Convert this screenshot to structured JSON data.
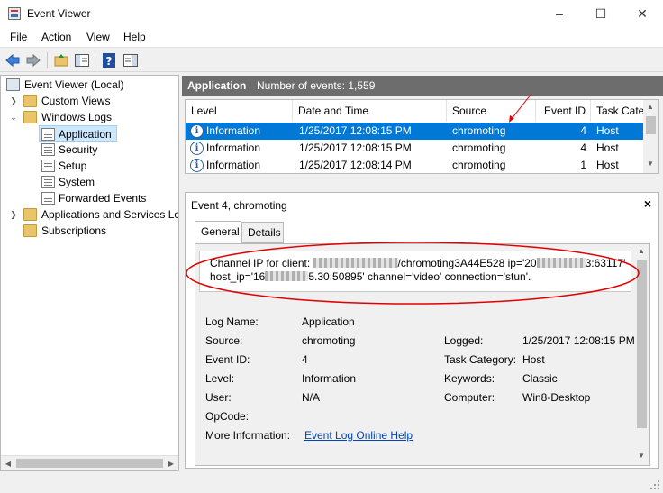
{
  "window": {
    "title": "Event Viewer",
    "controls": [
      "minimize",
      "maximize",
      "close"
    ]
  },
  "menu": [
    "File",
    "Action",
    "View",
    "Help"
  ],
  "toolbar": {
    "icons": [
      "back-icon",
      "forward-icon",
      "up-folder-icon",
      "show-hide-tree-icon",
      "help-icon",
      "show-hide-action-pane-icon"
    ]
  },
  "tree": {
    "items": [
      {
        "label": "Event Viewer (Local)",
        "level": 0,
        "icon": "computer-icon",
        "expander": ""
      },
      {
        "label": "Custom Views",
        "level": 1,
        "icon": "folder-icon",
        "expander": "collapsed"
      },
      {
        "label": "Windows Logs",
        "level": 1,
        "icon": "folder-icon",
        "expander": "expanded"
      },
      {
        "label": "Application",
        "level": 2,
        "icon": "log-icon",
        "expander": "",
        "selected": true
      },
      {
        "label": "Security",
        "level": 2,
        "icon": "log-icon",
        "expander": ""
      },
      {
        "label": "Setup",
        "level": 2,
        "icon": "log-icon",
        "expander": ""
      },
      {
        "label": "System",
        "level": 2,
        "icon": "log-icon",
        "expander": ""
      },
      {
        "label": "Forwarded Events",
        "level": 2,
        "icon": "log-icon",
        "expander": ""
      },
      {
        "label": "Applications and Services Lo",
        "level": 1,
        "icon": "folder-icon",
        "expander": "collapsed"
      },
      {
        "label": "Subscriptions",
        "level": 1,
        "icon": "folder-icon",
        "expander": ""
      }
    ]
  },
  "log_header": {
    "title": "Application",
    "count": "Number of events: 1,559"
  },
  "events": {
    "columns": [
      "Level",
      "Date and Time",
      "Source",
      "Event ID",
      "Task Categ"
    ],
    "rows": [
      {
        "level": "Information",
        "datetime": "1/25/2017 12:08:15 PM",
        "source": "chromoting",
        "event_id": "4",
        "task": "Host",
        "selected": true
      },
      {
        "level": "Information",
        "datetime": "1/25/2017 12:08:15 PM",
        "source": "chromoting",
        "event_id": "4",
        "task": "Host"
      },
      {
        "level": "Information",
        "datetime": "1/25/2017 12:08:14 PM",
        "source": "chromoting",
        "event_id": "1",
        "task": "Host"
      }
    ]
  },
  "detail": {
    "title": "Event 4, chromoting",
    "close": "×",
    "tabs": [
      "General",
      "Details"
    ],
    "message": {
      "line1_a": "Channel IP for client: ",
      "line1_b": "/chromoting3A44E528 ip='20",
      "line1_c": "3:63117'",
      "line2_a": "host_ip='16",
      "line2_b": "5.30:50895' channel='video' connection='stun'."
    },
    "fields": {
      "log_name_label": "Log Name:",
      "log_name": "Application",
      "source_label": "Source:",
      "source": "chromoting",
      "logged_label": "Logged:",
      "logged": "1/25/2017 12:08:15 PM",
      "event_id_label": "Event ID:",
      "event_id": "4",
      "task_label": "Task Category:",
      "task": "Host",
      "level_label": "Level:",
      "level": "Information",
      "keywords_label": "Keywords:",
      "keywords": "Classic",
      "user_label": "User:",
      "user": "N/A",
      "computer_label": "Computer:",
      "computer": "Win8-Desktop",
      "opcode_label": "OpCode:",
      "more_info_label": "More Information:",
      "more_info_link": "Event Log Online Help"
    }
  },
  "colors": {
    "selection": "#0078d7",
    "tree_selection": "#cce8ff",
    "header_bar": "#6d6d6d",
    "annotation": "#e00000",
    "link": "#0645ad"
  }
}
